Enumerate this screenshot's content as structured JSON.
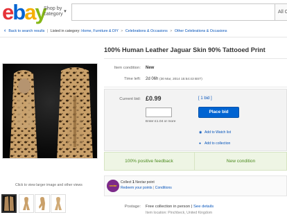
{
  "header": {
    "logo": {
      "e": "e",
      "b": "b",
      "a": "a",
      "y": "y"
    },
    "shop_by_line1": "Shop by",
    "shop_by_line2": "category",
    "search_placeholder": "",
    "category_select": "All Ca"
  },
  "breadcrumb": {
    "back": "Back to search results",
    "listed_in": "Listed in category:",
    "items": [
      "Home, Furniture & DIY",
      "Celebrations & Occasions",
      "Other Celebrations & Occasions"
    ]
  },
  "listing": {
    "title": "100% Human Leather Jaguar Skin 90% Tattooed Print",
    "condition_label": "Item condition:",
    "condition_value": "New",
    "time_left_label": "Time left:",
    "time_left_value": "2d 06h",
    "time_left_detail": "(30 Mar, 2014   15:54:43 BST)",
    "current_bid_label": "Current bid:",
    "current_bid_value": "£0.99",
    "bid_count": "[ 1 bid ]",
    "bid_input_value": "",
    "place_bid": "Place bid",
    "enter_note": "Enter £1.04 or more",
    "watch_list": "Add to Watch list",
    "add_collection": "Add to collection",
    "feedback": "100% positive feedback",
    "new_condition": "New condition",
    "nectar_logo": "nectar",
    "nectar_line1_pre": "Collect",
    "nectar_line1_bold": "1",
    "nectar_line1_post": "Nectar point",
    "nectar_redeem": "Redeem your points",
    "nectar_conditions": "Conditions",
    "postage_label": "Postage:",
    "postage_value": "Free collection in person",
    "postage_link": "See details",
    "postage_cut": "Item location: Pinchbeck, United Kingdom"
  },
  "images": {
    "view_larger": "Click to view larger image and other views",
    "thumb_count": 4
  },
  "colors": {
    "ebay_red": "#e53238",
    "ebay_blue": "#0064d2",
    "ebay_yellow": "#f5af02",
    "ebay_green": "#86b817",
    "link": "#0654ba",
    "feedback_green": "#4b8a1e"
  }
}
